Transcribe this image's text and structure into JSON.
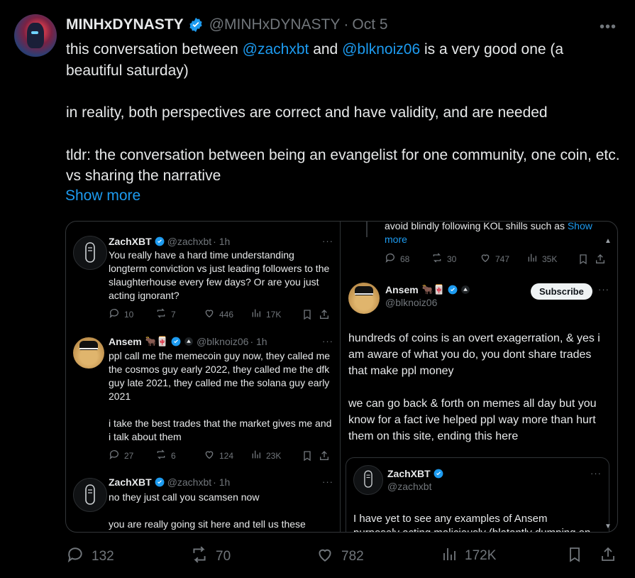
{
  "tweet": {
    "name": "MINHxDYNASTY",
    "handle": "@MINHxDYNASTY",
    "separator": "·",
    "date": "Oct 5",
    "more": "•••",
    "line1_pre": "this conversation between ",
    "mention1": "@zachxbt",
    "line1_mid": " and ",
    "mention2": "@blknoiz06",
    "line1_post": " is a very good one (a beautiful saturday)",
    "para2": "in reality, both perspectives are correct and have validity, and are needed",
    "para3": "tldr: the conversation between being an evangelist for one community, one coin, etc. vs sharing the narrative",
    "show_more": "Show more",
    "actions": {
      "replies": "132",
      "reposts": "70",
      "likes": "782",
      "views": "172K"
    }
  },
  "embed": {
    "left": {
      "post1": {
        "name": "ZachXBT",
        "handle": "@zachxbt",
        "time": "· 1h",
        "more": "···",
        "text": "You really have a hard time understanding longterm conviction vs just leading followers to the slaughterhouse every few days? Or are you just acting ignorant?",
        "replies": "10",
        "reposts": "7",
        "likes": "446",
        "views": "17K"
      },
      "post2": {
        "name": "Ansem",
        "emojis": "🐂🀄",
        "handle": "@blknoiz06",
        "time": "· 1h",
        "more": "···",
        "text1": "ppl call me the memecoin guy now, they called me the cosmos guy early 2022, they called me the dfk guy late 2021, they called me the solana guy early 2021",
        "text2": "i take the best trades that the market gives me and i talk about them",
        "replies": "27",
        "reposts": "6",
        "likes": "124",
        "views": "23K"
      },
      "post3": {
        "name": "ZachXBT",
        "handle": "@zachxbt",
        "time": "· 1h",
        "more": "···",
        "text1": "no they just call you scamsen now",
        "text2": "you are really going sit here and tell us these"
      }
    },
    "right": {
      "top_text": "avoid blindly following KOL shills such as ",
      "top_show": "Show",
      "top_more": "more",
      "top_replies": "68",
      "top_reposts": "30",
      "top_likes": "747",
      "top_views": "35K",
      "main": {
        "name": "Ansem",
        "emojis": "🐂🀄",
        "handle": "@blknoiz06",
        "subscribe": "Subscribe",
        "more": "···",
        "text1": "hundreds of coins is an overt exagerration, & yes i am aware of what you do, you dont share trades that make ppl money",
        "text2": "we can go back & forth on memes all day but you know for a fact ive helped ppl way more than hurt them on this site, ending this here"
      },
      "quote": {
        "name": "ZachXBT",
        "handle": "@zachxbt",
        "more": "···",
        "text1": "I have yet to see any examples of Ansem",
        "text2": "purposely acting maliciously (blatantly dumping on"
      }
    }
  },
  "colors": {
    "accent": "#1d9bf0",
    "muted": "#71767b",
    "text": "#e7e9ea",
    "background": "#000000"
  }
}
